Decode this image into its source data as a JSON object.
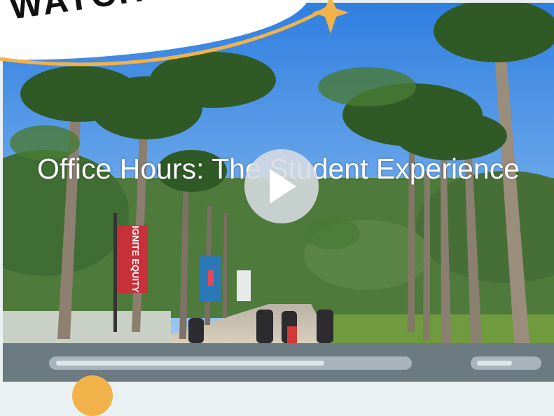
{
  "banner": {
    "text": "WATCH NOW"
  },
  "video": {
    "title": "Office Hours: The Student Experience",
    "banners": {
      "red_banner": "IGNITE EQUITY"
    }
  },
  "player": {
    "progress_fraction": 0.77,
    "volume_fraction": 0.6
  },
  "colors": {
    "banner_accent": "#f2b24a",
    "control_bar": "#6c7a82",
    "track": "#a8b3bb",
    "track_fill": "#dfe5e8"
  },
  "icons": [
    "play-icon",
    "star-icon"
  ]
}
